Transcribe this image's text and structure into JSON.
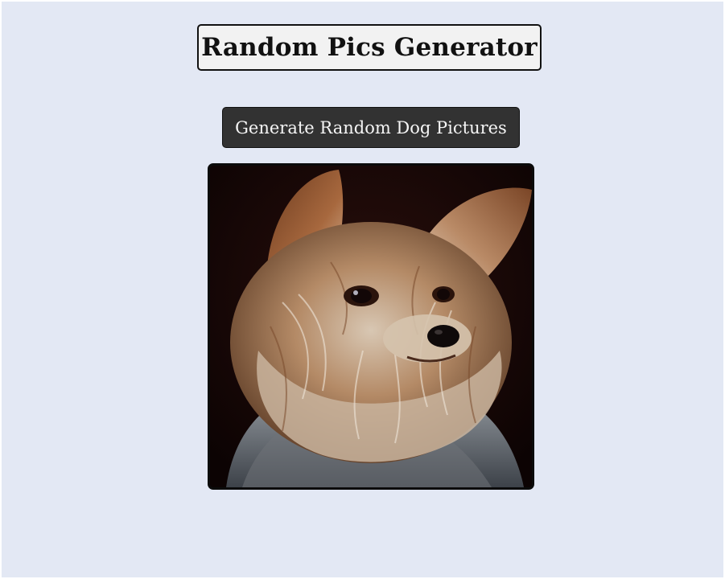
{
  "header": {
    "title": "Random Pics Generator"
  },
  "actions": {
    "generate_label": "Generate Random Dog Pictures"
  },
  "image": {
    "subject": "Yorkshire terrier dog"
  },
  "colors": {
    "page_background": "#e3e8f4",
    "title_background": "#f2f2f2",
    "button_background": "#323232",
    "button_text": "#f5f5f5"
  }
}
